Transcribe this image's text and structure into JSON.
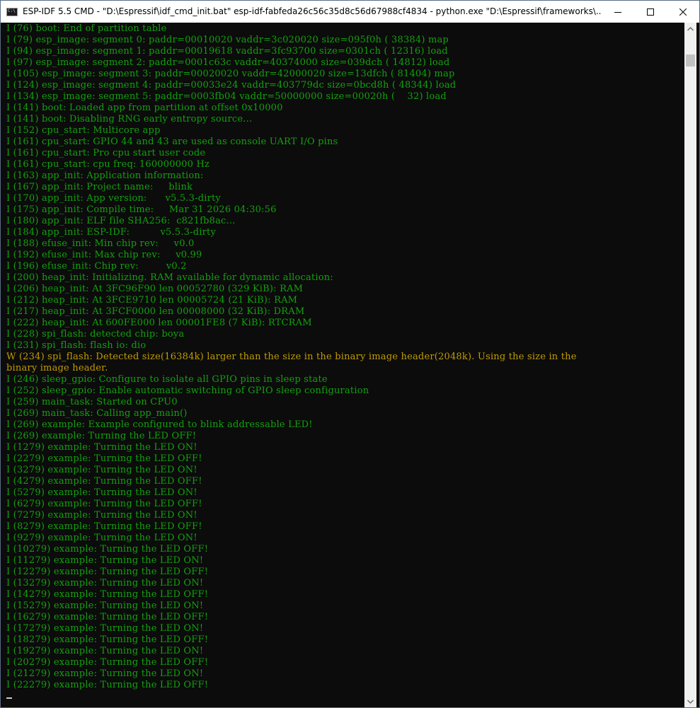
{
  "window": {
    "title": "ESP-IDF 5.5 CMD - \"D:\\Espressif\\idf_cmd_init.bat\"  esp-idf-fabfeda26c56c35d8c56d67988cf4834 - python.exe  \"D:\\Espressif\\frameworks\\...",
    "icon": "console-icon"
  },
  "colors": {
    "background": "#0c0c0c",
    "info_text": "#13a10e",
    "warn_text": "#c19c00"
  },
  "console": {
    "lines": [
      {
        "level": "info",
        "text": "I (76) boot: End of partition table"
      },
      {
        "level": "info",
        "text": "I (79) esp_image: segment 0: paddr=00010020 vaddr=3c020020 size=095f0h ( 38384) map"
      },
      {
        "level": "info",
        "text": "I (94) esp_image: segment 1: paddr=00019618 vaddr=3fc93700 size=0301ch ( 12316) load"
      },
      {
        "level": "info",
        "text": "I (97) esp_image: segment 2: paddr=0001c63c vaddr=40374000 size=039dch ( 14812) load"
      },
      {
        "level": "info",
        "text": "I (105) esp_image: segment 3: paddr=00020020 vaddr=42000020 size=13dfch ( 81404) map"
      },
      {
        "level": "info",
        "text": "I (124) esp_image: segment 4: paddr=00033e24 vaddr=403779dc size=0bcd8h ( 48344) load"
      },
      {
        "level": "info",
        "text": "I (134) esp_image: segment 5: paddr=0003fb04 vaddr=50000000 size=00020h (    32) load"
      },
      {
        "level": "info",
        "text": "I (141) boot: Loaded app from partition at offset 0x10000"
      },
      {
        "level": "info",
        "text": "I (141) boot: Disabling RNG early entropy source..."
      },
      {
        "level": "info",
        "text": "I (152) cpu_start: Multicore app"
      },
      {
        "level": "info",
        "text": "I (161) cpu_start: GPIO 44 and 43 are used as console UART I/O pins"
      },
      {
        "level": "info",
        "text": "I (161) cpu_start: Pro cpu start user code"
      },
      {
        "level": "info",
        "text": "I (161) cpu_start: cpu freq: 160000000 Hz"
      },
      {
        "level": "info",
        "text": "I (163) app_init: Application information:"
      },
      {
        "level": "info",
        "text": "I (167) app_init: Project name:     blink"
      },
      {
        "level": "info",
        "text": "I (170) app_init: App version:      v5.5.3-dirty"
      },
      {
        "level": "info",
        "text": "I (175) app_init: Compile time:     Mar 31 2026 04:30:56"
      },
      {
        "level": "info",
        "text": "I (180) app_init: ELF file SHA256:  c821fb8ac..."
      },
      {
        "level": "info",
        "text": "I (184) app_init: ESP-IDF:          v5.5.3-dirty"
      },
      {
        "level": "info",
        "text": "I (188) efuse_init: Min chip rev:     v0.0"
      },
      {
        "level": "info",
        "text": "I (192) efuse_init: Max chip rev:     v0.99"
      },
      {
        "level": "info",
        "text": "I (196) efuse_init: Chip rev:         v0.2"
      },
      {
        "level": "info",
        "text": "I (200) heap_init: Initializing. RAM available for dynamic allocation:"
      },
      {
        "level": "info",
        "text": "I (206) heap_init: At 3FC96F90 len 00052780 (329 KiB): RAM"
      },
      {
        "level": "info",
        "text": "I (212) heap_init: At 3FCE9710 len 00005724 (21 KiB): RAM"
      },
      {
        "level": "info",
        "text": "I (217) heap_init: At 3FCF0000 len 00008000 (32 KiB): DRAM"
      },
      {
        "level": "info",
        "text": "I (222) heap_init: At 600FE000 len 00001FE8 (7 KiB): RTCRAM"
      },
      {
        "level": "info",
        "text": "I (228) spi_flash: detected chip: boya"
      },
      {
        "level": "info",
        "text": "I (231) spi_flash: flash io: dio"
      },
      {
        "level": "warn",
        "text": "W (234) spi_flash: Detected size(16384k) larger than the size in the binary image header(2048k). Using the size in the"
      },
      {
        "level": "warn",
        "text": "binary image header."
      },
      {
        "level": "info",
        "text": "I (246) sleep_gpio: Configure to isolate all GPIO pins in sleep state"
      },
      {
        "level": "info",
        "text": "I (252) sleep_gpio: Enable automatic switching of GPIO sleep configuration"
      },
      {
        "level": "info",
        "text": "I (259) main_task: Started on CPU0"
      },
      {
        "level": "info",
        "text": "I (269) main_task: Calling app_main()"
      },
      {
        "level": "info",
        "text": "I (269) example: Example configured to blink addressable LED!"
      },
      {
        "level": "info",
        "text": "I (269) example: Turning the LED OFF!"
      },
      {
        "level": "info",
        "text": "I (1279) example: Turning the LED ON!"
      },
      {
        "level": "info",
        "text": "I (2279) example: Turning the LED OFF!"
      },
      {
        "level": "info",
        "text": "I (3279) example: Turning the LED ON!"
      },
      {
        "level": "info",
        "text": "I (4279) example: Turning the LED OFF!"
      },
      {
        "level": "info",
        "text": "I (5279) example: Turning the LED ON!"
      },
      {
        "level": "info",
        "text": "I (6279) example: Turning the LED OFF!"
      },
      {
        "level": "info",
        "text": "I (7279) example: Turning the LED ON!"
      },
      {
        "level": "info",
        "text": "I (8279) example: Turning the LED OFF!"
      },
      {
        "level": "info",
        "text": "I (9279) example: Turning the LED ON!"
      },
      {
        "level": "info",
        "text": "I (10279) example: Turning the LED OFF!"
      },
      {
        "level": "info",
        "text": "I (11279) example: Turning the LED ON!"
      },
      {
        "level": "info",
        "text": "I (12279) example: Turning the LED OFF!"
      },
      {
        "level": "info",
        "text": "I (13279) example: Turning the LED ON!"
      },
      {
        "level": "info",
        "text": "I (14279) example: Turning the LED OFF!"
      },
      {
        "level": "info",
        "text": "I (15279) example: Turning the LED ON!"
      },
      {
        "level": "info",
        "text": "I (16279) example: Turning the LED OFF!"
      },
      {
        "level": "info",
        "text": "I (17279) example: Turning the LED ON!"
      },
      {
        "level": "info",
        "text": "I (18279) example: Turning the LED OFF!"
      },
      {
        "level": "info",
        "text": "I (19279) example: Turning the LED ON!"
      },
      {
        "level": "info",
        "text": "I (20279) example: Turning the LED OFF!"
      },
      {
        "level": "info",
        "text": "I (21279) example: Turning the LED ON!"
      },
      {
        "level": "info",
        "text": "I (22279) example: Turning the LED OFF!"
      }
    ]
  }
}
